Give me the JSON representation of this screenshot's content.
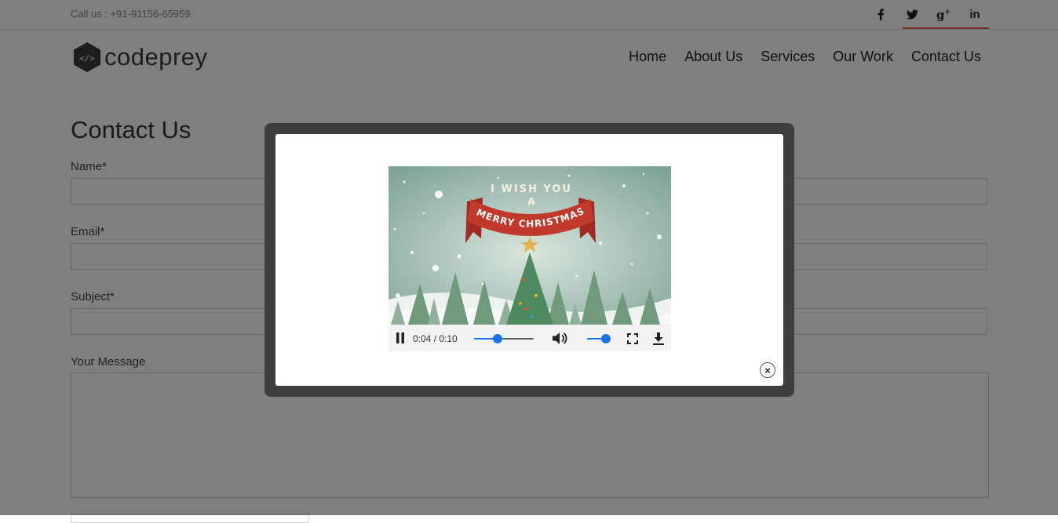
{
  "header": {
    "phone": "Call us : +91-91156-65959",
    "social": [
      {
        "icon": "facebook-icon",
        "label": "f"
      },
      {
        "icon": "twitter-icon",
        "label": "t"
      },
      {
        "icon": "google-plus-icon",
        "label": "g+"
      },
      {
        "icon": "linkedin-icon",
        "label": "in"
      }
    ],
    "logo_text": "codeprey",
    "nav": [
      "Home",
      "About Us",
      "Services",
      "Our Work",
      "Contact Us"
    ]
  },
  "form": {
    "title": "Contact Us",
    "name_label": "Name*",
    "email_label": "Email*",
    "subject_label": "Subject*",
    "message_label": "Your Message"
  },
  "modal": {
    "video": {
      "banner_top": "I WISH YOU",
      "banner_mid": "A",
      "banner_ribbon": "MERRY CHRISTMAS",
      "time": "0:04 / 0:10",
      "progress_fraction": 0.4,
      "volume_fraction": 0.8,
      "state": "playing"
    },
    "close_label": "×"
  },
  "colors": {
    "accent": "#e0532e",
    "player_blue": "#1a73e8",
    "ribbon_red": "#c0392b"
  }
}
